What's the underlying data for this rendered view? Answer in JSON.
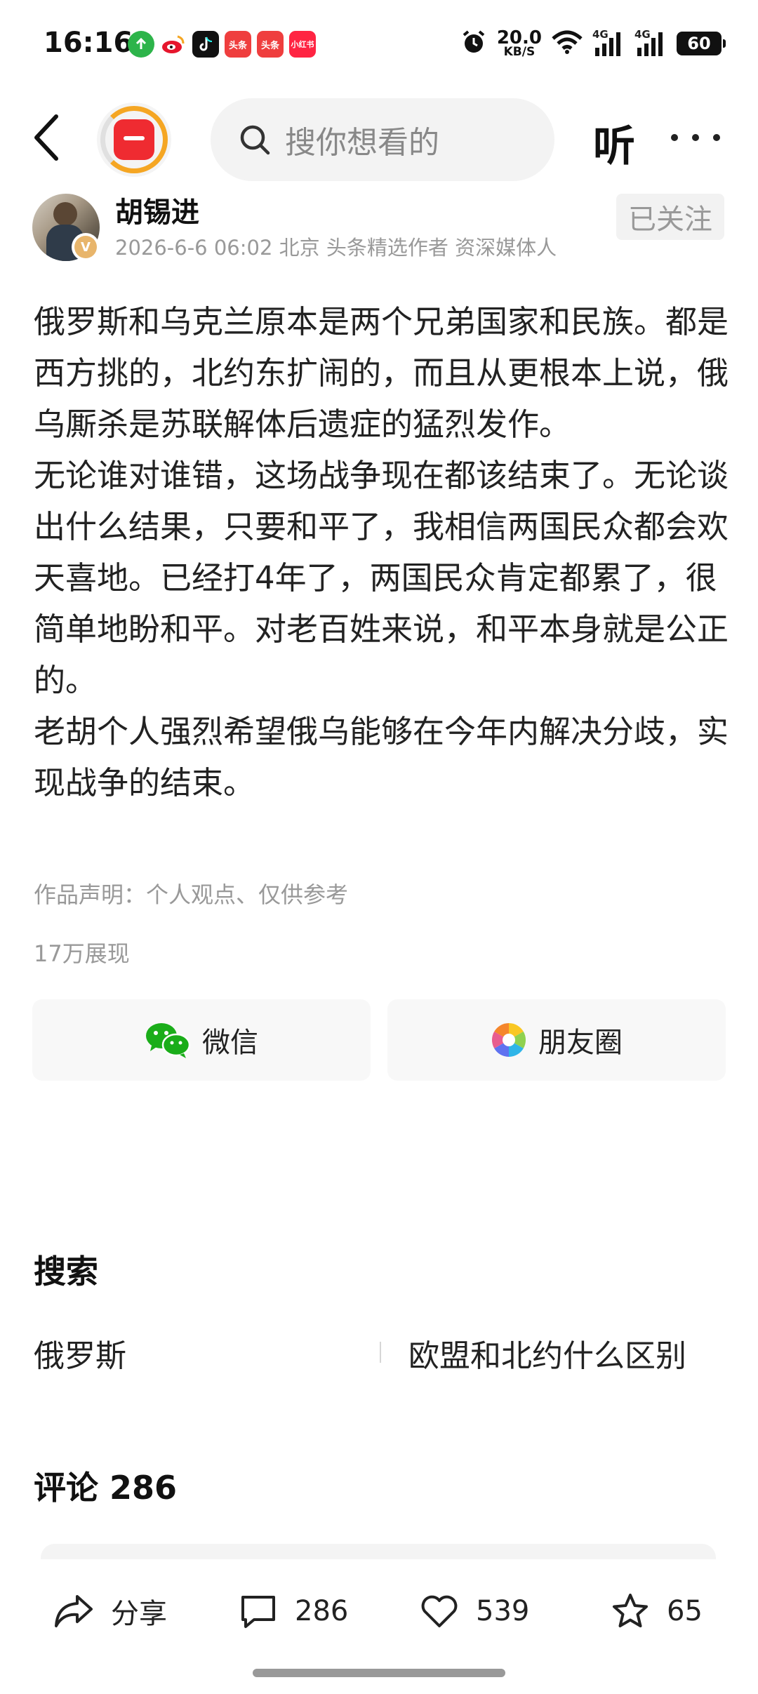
{
  "status_bar": {
    "time": "16:16",
    "apps": [
      {
        "icon": "app-store-icon",
        "label": "",
        "color": "#2db44a"
      },
      {
        "icon": "weibo-icon",
        "label": "",
        "color": "#f5c033"
      },
      {
        "icon": "tiktok-icon",
        "label": "",
        "color": "#111111"
      },
      {
        "icon": "toutiao-icon",
        "label": "头条",
        "color": "#ef3e3e"
      },
      {
        "icon": "toutiao-lite-icon",
        "label": "头条",
        "color": "#ef3e3e"
      },
      {
        "icon": "xiaohongshu-icon",
        "label": "小红书",
        "color": "#ff2442"
      }
    ],
    "net_speed": "20.0",
    "net_unit": "KB/S",
    "signal_1": "4G",
    "signal_2": "4G",
    "battery": "60"
  },
  "nav": {
    "search_placeholder": "搜你想看的",
    "listen_label": "听"
  },
  "author": {
    "name": "胡锡进",
    "meta": "2026-6-6 06:02 北京 头条精选作者 资深媒体人",
    "follow_label": "已关注",
    "badge": "V"
  },
  "article": {
    "paragraphs": [
      "俄罗斯和乌克兰原本是两个兄弟国家和民族。都是西方挑的，北约东扩闹的，而且从更根本上说，俄乌厮杀是苏联解体后遗症的猛烈发作。",
      "无论谁对谁错，这场战争现在都该结束了。无论谈出什么结果，只要和平了，我相信两国民众都会欢天喜地。已经打4年了，两国民众肯定都累了，很简单地盼和平。对老百姓来说，和平本身就是公正的。",
      "老胡个人强烈希望俄乌能够在今年内解决分歧，实现战争的结束。"
    ],
    "declaration": "作品声明：个人观点、仅供参考",
    "views": "17万展现"
  },
  "share": {
    "wechat_label": "微信",
    "moments_label": "朋友圈"
  },
  "search_section": {
    "title": "搜索",
    "items": [
      "俄罗斯",
      "欧盟和北约什么区别"
    ]
  },
  "comments": {
    "title": "评论 286"
  },
  "bottom_bar": {
    "share_label": "分享",
    "comment_count": "286",
    "like_count": "539",
    "favorite_count": "65"
  },
  "colors": {
    "text_primary": "#222222",
    "text_secondary": "#999999",
    "wechat_green": "#1aad19",
    "logo_red": "#ef2b31",
    "logo_orange": "#f5a623"
  }
}
